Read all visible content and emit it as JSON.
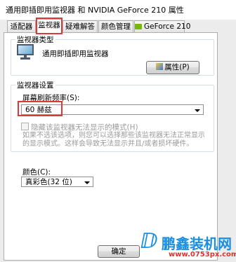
{
  "window": {
    "title": "通用即插即用监视器 和 NVIDIA GeForce 210 属性"
  },
  "tabs": [
    {
      "label": "适配器",
      "active": false
    },
    {
      "label": "监视器",
      "active": true
    },
    {
      "label": "疑难解答",
      "active": false
    },
    {
      "label": "颜色管理",
      "active": false
    },
    {
      "label": "GeForce 210",
      "active": false
    }
  ],
  "monitor_type": {
    "group_title": "监视器类型",
    "monitor_name": "通用即插即用监视器",
    "properties_button": "属性(P)"
  },
  "monitor_settings": {
    "group_title": "监视器设置",
    "refresh_label": "屏幕刷新频率(S):",
    "refresh_value": "60 赫兹",
    "hide_modes_label": "隐藏该监视器无法显示的模式(H)",
    "hide_modes_checked": false,
    "hide_modes_help": "如果不选该选项，则您可以选择那些该监视器无法正常显示的显示模式。这样会导致无法显示并且/或者损坏硬件。"
  },
  "colors": {
    "label": "颜色(C):",
    "value": "真彩色(32 位)"
  },
  "footer": {
    "ok_button": "确定"
  },
  "watermark": {
    "brand": "鹏鑫装机网",
    "url": "www.0753px.com"
  },
  "colors_theme": {
    "highlight": "#d93a3a",
    "watermark_blue": "#1a8ee0",
    "watermark_red": "#e03030",
    "nvidia_green": "#76b900"
  }
}
